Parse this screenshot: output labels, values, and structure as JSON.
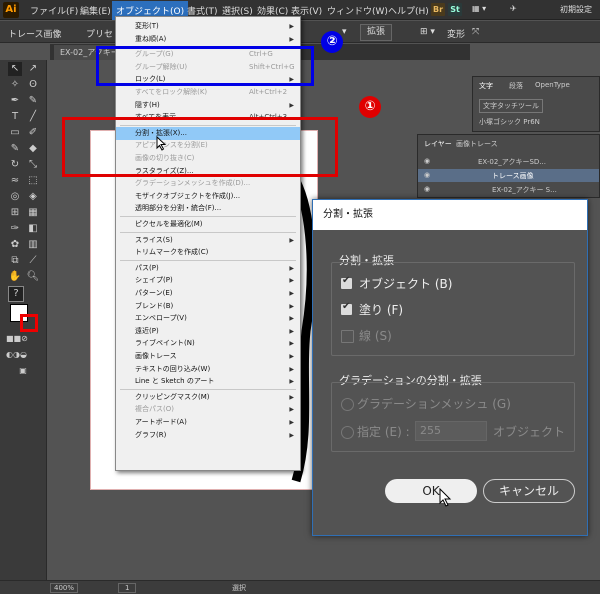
{
  "menubar": {
    "logo": "Ai",
    "items": [
      "ファイル(F)",
      "編集(E)",
      "オブジェクト(O)",
      "書式(T)",
      "選択(S)",
      "効果(C)",
      "表示(V)",
      "ウィンドウ(W)",
      "ヘルプ(H)"
    ],
    "app_icons": [
      "Br",
      "St"
    ],
    "workspace": "初期設定"
  },
  "control_bar": {
    "left_label": "トレース画像",
    "preset_label": "プリセ",
    "expand_button": "拡張",
    "transform_label": "変形"
  },
  "doc_tab": "EX-02_アクキー",
  "object_menu": {
    "items": [
      {
        "label": "変形(T)",
        "shortcut": "",
        "submenu": true,
        "disabled": false
      },
      {
        "label": "重ね順(A)",
        "shortcut": "",
        "submenu": true,
        "disabled": false
      },
      {
        "sep": true
      },
      {
        "label": "グループ(G)",
        "shortcut": "Ctrl+G",
        "submenu": false,
        "disabled": true
      },
      {
        "label": "グループ解除(U)",
        "shortcut": "Shift+Ctrl+G",
        "submenu": false,
        "disabled": true
      },
      {
        "label": "ロック(L)",
        "shortcut": "",
        "submenu": true,
        "disabled": false
      },
      {
        "label": "すべてをロック解除(K)",
        "shortcut": "Alt+Ctrl+2",
        "submenu": false,
        "disabled": true
      },
      {
        "label": "隠す(H)",
        "shortcut": "",
        "submenu": true,
        "disabled": false
      },
      {
        "label": "すべてを表示",
        "shortcut": "Alt+Ctrl+3",
        "submenu": false,
        "disabled": false
      },
      {
        "sep": true
      },
      {
        "label": "分割・拡張(X)...",
        "shortcut": "",
        "submenu": false,
        "disabled": false,
        "highlight": true
      },
      {
        "label": "アピアランスを分割(E)",
        "shortcut": "",
        "submenu": false,
        "disabled": true
      },
      {
        "label": "画像の切り抜き(C)",
        "shortcut": "",
        "submenu": false,
        "disabled": true
      },
      {
        "label": "ラスタライズ(Z)...",
        "shortcut": "",
        "submenu": false,
        "disabled": false
      },
      {
        "label": "グラデーションメッシュを作成(D)...",
        "shortcut": "",
        "submenu": false,
        "disabled": true
      },
      {
        "label": "モザイクオブジェクトを作成(J)...",
        "shortcut": "",
        "submenu": false,
        "disabled": false
      },
      {
        "label": "透明部分を分割・統合(F)...",
        "shortcut": "",
        "submenu": false,
        "disabled": false
      },
      {
        "sep": true
      },
      {
        "label": "ピクセルを最適化(M)",
        "shortcut": "",
        "submenu": false,
        "disabled": false
      },
      {
        "sep": true
      },
      {
        "label": "スライス(S)",
        "shortcut": "",
        "submenu": true,
        "disabled": false
      },
      {
        "label": "トリムマークを作成(C)",
        "shortcut": "",
        "submenu": false,
        "disabled": false
      },
      {
        "sep": true
      },
      {
        "label": "パス(P)",
        "shortcut": "",
        "submenu": true,
        "disabled": false
      },
      {
        "label": "シェイプ(P)",
        "shortcut": "",
        "submenu": true,
        "disabled": false
      },
      {
        "label": "パターン(E)",
        "shortcut": "",
        "submenu": true,
        "disabled": false
      },
      {
        "label": "ブレンド(B)",
        "shortcut": "",
        "submenu": true,
        "disabled": false
      },
      {
        "label": "エンベロープ(V)",
        "shortcut": "",
        "submenu": true,
        "disabled": false
      },
      {
        "label": "遠近(P)",
        "shortcut": "",
        "submenu": true,
        "disabled": false
      },
      {
        "label": "ライブペイント(N)",
        "shortcut": "",
        "submenu": true,
        "disabled": false
      },
      {
        "label": "画像トレース",
        "shortcut": "",
        "submenu": true,
        "disabled": false
      },
      {
        "label": "テキストの回り込み(W)",
        "shortcut": "",
        "submenu": true,
        "disabled": false
      },
      {
        "label": "Line と Sketch のアート",
        "shortcut": "",
        "submenu": true,
        "disabled": false
      },
      {
        "sep": true
      },
      {
        "label": "クリッピングマスク(M)",
        "shortcut": "",
        "submenu": true,
        "disabled": false
      },
      {
        "label": "複合パス(O)",
        "shortcut": "",
        "submenu": true,
        "disabled": true
      },
      {
        "label": "アートボード(A)",
        "shortcut": "",
        "submenu": true,
        "disabled": false
      },
      {
        "label": "グラフ(R)",
        "shortcut": "",
        "submenu": true,
        "disabled": false
      }
    ]
  },
  "char_panel": {
    "tabs": [
      "文字",
      "段落",
      "OpenType"
    ],
    "touch_tool": "文字タッチツール",
    "font": "小塚ゴシック Pr6N"
  },
  "layers_panel": {
    "tabs": [
      "レイヤー",
      "画像トレース"
    ],
    "rows": [
      "EX-02_アクキーSD...",
      "トレース画像",
      "EX-02_アクキー S..."
    ]
  },
  "dialog": {
    "title": "分割・拡張",
    "group1_title": "分割・拡張",
    "opt_object": "オブジェクト (B)",
    "opt_fill": "塗り (F)",
    "opt_stroke": "線 (S)",
    "group2_title": "グラデーションの分割・拡張",
    "opt_mesh": "グラデーションメッシュ (G)",
    "opt_specify": "指定 (E) :",
    "specify_value": "255",
    "specify_unit": "オブジェクト",
    "ok": "OK",
    "cancel": "キャンセル"
  },
  "status_bar": {
    "zoom": "400%",
    "page": "1",
    "mode": "選択"
  },
  "annotations": {
    "badge1": "①",
    "badge2": "②",
    "red": "#e00000",
    "blue": "#0000e6"
  }
}
